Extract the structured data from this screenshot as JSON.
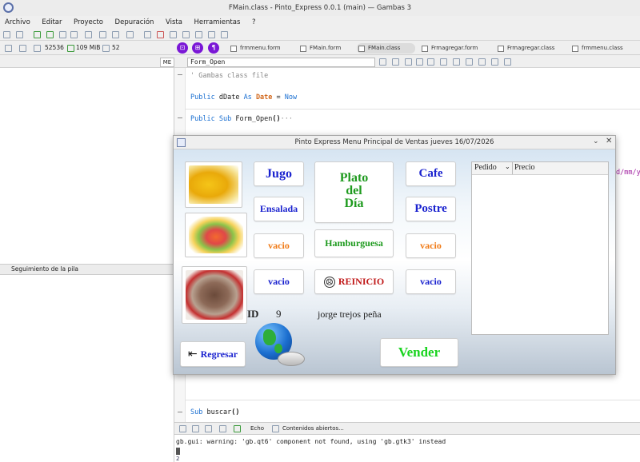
{
  "window": {
    "title": "FMain.class - Pinto_Express 0.0.1 (main) — Gambas 3"
  },
  "menu": [
    "Archivo",
    "Editar",
    "Proyecto",
    "Depuración",
    "Vista",
    "Herramientas",
    "?"
  ],
  "left": {
    "stat_1": "52536",
    "stat_2": "109 MiB",
    "stat_3": "52",
    "me_label": "ME",
    "stack_title": "Seguimiento de la pila"
  },
  "tabs": [
    "frmmenu.form",
    "FMain.form",
    "FMain.class",
    "Frmagregar.form",
    "Frmagregar.class",
    "frmmenu.class"
  ],
  "active_tab": "FMain.class",
  "editor": {
    "procedure": "Form_Open",
    "lines": {
      "comment": "' Gambas class file",
      "public_kw": "Public",
      "ddate_decl": "dDate",
      "as_kw": "As",
      "type_kw": "Date",
      "eq": "=",
      "now_kw": "Now",
      "sub_kw": "Sub",
      "form_open": "Form_Open",
      "parens": "()",
      "dots": "···",
      "partial_code": "d/mm/y",
      "sub_buscar_kw": "Sub",
      "sub_buscar": "buscar",
      "sub_buscar_parens": "()"
    }
  },
  "console": {
    "echo_label": "Echo",
    "open_label": "Contenidos abiertos...",
    "output": "gb.gui: warning: 'gb.qt6' component not found, using 'gb.gtk3' instead",
    "line_num": "2"
  },
  "dialog": {
    "title": "Pinto Express Menu Principal de Ventas jueves 16/07/2026",
    "buttons": {
      "jugo": "Jugo",
      "ensalada": "Ensalada",
      "vacio_1": "vacio",
      "vacio_2": "vacio",
      "plato_del_dia": "Plato\ndel\nDía",
      "hamburguesa": "Hamburguesa",
      "reinicio": "REINICIO",
      "cafe": "Cafe",
      "postre": "Postre",
      "vacio_3": "vacio",
      "vacio_4": "vacio",
      "regresar": "Regresar",
      "vender": "Vender"
    },
    "grid_headers": [
      "Pedido",
      "Precio"
    ],
    "id_label": "ID",
    "id_value": "9",
    "user_name": "jorge trejos peña"
  },
  "colors": {
    "accent_purple": "#7a17d6",
    "blue_text": "#1a22cf",
    "orange_text": "#f07a16",
    "green_text": "#1e9a1e",
    "vender_green": "#19d41f"
  }
}
